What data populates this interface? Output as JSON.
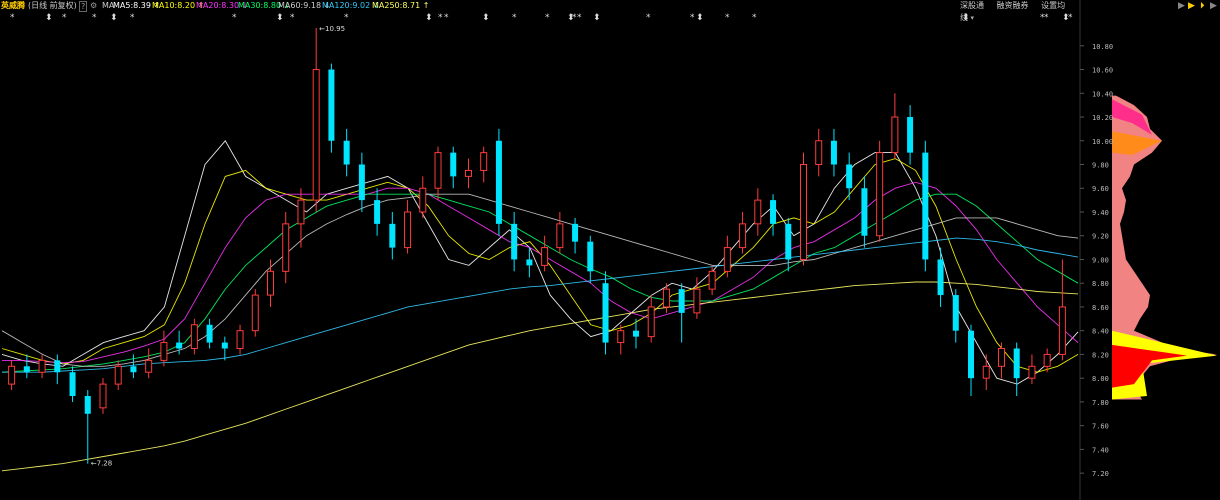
{
  "header": {
    "stock_name": "英威腾",
    "period_label": "(日线 前复权)",
    "help_icon": "?",
    "ma_label": "MA",
    "ma_items": [
      {
        "label": "MA5:8.39",
        "color": "#ffffff",
        "arrow": "↑"
      },
      {
        "label": "MA10:8.20",
        "color": "#ffff00",
        "arrow": "↑"
      },
      {
        "label": "MA20:8.30",
        "color": "#ff33ff",
        "arrow": "↓"
      },
      {
        "label": "MA30:8.80",
        "color": "#00ff66",
        "arrow": "↓"
      },
      {
        "label": "MA60:9.18",
        "color": "#cccccc",
        "arrow": "↓"
      },
      {
        "label": "MA120:9.02",
        "color": "#33ccff",
        "arrow": "↓"
      },
      {
        "label": "MA250:8.71",
        "color": "#ffff66",
        "arrow": "↑"
      }
    ],
    "right_buttons": [
      "深股通",
      "融资融券",
      "设置均线"
    ],
    "right_caret": "▾"
  },
  "chart_data": {
    "type": "candlestick",
    "y_axis": {
      "min": 7.1,
      "max": 10.95,
      "ticks": [
        "10.80",
        "10.60",
        "10.40",
        "10.20",
        "10.00",
        "9.80",
        "9.60",
        "9.40",
        "9.20",
        "9.00",
        "8.80",
        "8.60",
        "8.40",
        "8.20",
        "8.00",
        "7.80",
        "7.60",
        "7.40",
        "7.20"
      ]
    },
    "annotations": [
      {
        "text": "10.95",
        "value": 10.95
      },
      {
        "text": "7.28",
        "value": 7.28
      }
    ],
    "series": [
      {
        "name": "MA5",
        "color": "#ffffff",
        "values": [
          8.2,
          8.15,
          8.12,
          8.1,
          8.2,
          8.3,
          8.35,
          8.4,
          8.6,
          9.2,
          9.8,
          10.0,
          9.7,
          9.6,
          9.5,
          9.4,
          9.55,
          9.6,
          9.65,
          9.7,
          9.6,
          9.3,
          9.0,
          8.95,
          9.1,
          9.25,
          9.1,
          8.7,
          8.5,
          8.35,
          8.4,
          8.55,
          8.7,
          8.8,
          8.75,
          8.9,
          9.1,
          9.3,
          9.45,
          9.2,
          9.3,
          9.6,
          9.8,
          9.9,
          9.9,
          9.6,
          9.2,
          8.6,
          8.3,
          8.0,
          7.95,
          8.05,
          8.2,
          8.39
        ]
      },
      {
        "name": "MA10",
        "color": "#ffff00",
        "values": [
          8.25,
          8.2,
          8.15,
          8.12,
          8.15,
          8.25,
          8.3,
          8.35,
          8.45,
          8.8,
          9.3,
          9.7,
          9.75,
          9.6,
          9.55,
          9.5,
          9.5,
          9.55,
          9.6,
          9.65,
          9.6,
          9.45,
          9.2,
          9.05,
          9.0,
          9.1,
          9.15,
          8.95,
          8.7,
          8.45,
          8.4,
          8.45,
          8.55,
          8.7,
          8.75,
          8.8,
          8.95,
          9.1,
          9.3,
          9.35,
          9.3,
          9.4,
          9.6,
          9.8,
          9.85,
          9.75,
          9.45,
          9.0,
          8.6,
          8.3,
          8.1,
          8.05,
          8.1,
          8.2
        ]
      },
      {
        "name": "MA20",
        "color": "#ff33ff",
        "values": [
          8.15,
          8.15,
          8.14,
          8.13,
          8.14,
          8.18,
          8.22,
          8.27,
          8.33,
          8.5,
          8.8,
          9.1,
          9.35,
          9.5,
          9.55,
          9.55,
          9.55,
          9.55,
          9.55,
          9.6,
          9.6,
          9.55,
          9.45,
          9.35,
          9.25,
          9.15,
          9.1,
          9.0,
          8.9,
          8.8,
          8.65,
          8.55,
          8.5,
          8.55,
          8.6,
          8.65,
          8.75,
          8.85,
          9.0,
          9.1,
          9.15,
          9.25,
          9.35,
          9.5,
          9.6,
          9.65,
          9.6,
          9.45,
          9.25,
          9.0,
          8.8,
          8.6,
          8.45,
          8.3
        ]
      },
      {
        "name": "MA30",
        "color": "#00ff66",
        "values": [
          8.05,
          8.06,
          8.07,
          8.08,
          8.1,
          8.12,
          8.15,
          8.18,
          8.22,
          8.3,
          8.5,
          8.75,
          8.95,
          9.1,
          9.25,
          9.35,
          9.45,
          9.5,
          9.55,
          9.55,
          9.55,
          9.55,
          9.5,
          9.45,
          9.4,
          9.3,
          9.2,
          9.1,
          9.0,
          8.92,
          8.85,
          8.75,
          8.68,
          8.65,
          8.65,
          8.65,
          8.7,
          8.75,
          8.85,
          8.95,
          9.05,
          9.1,
          9.2,
          9.3,
          9.4,
          9.5,
          9.55,
          9.55,
          9.45,
          9.3,
          9.15,
          9.0,
          8.9,
          8.8
        ]
      },
      {
        "name": "MA60",
        "color": "#cccccc",
        "values": [
          8.4,
          8.3,
          8.2,
          8.12,
          8.1,
          8.1,
          8.12,
          8.15,
          8.2,
          8.25,
          8.35,
          8.5,
          8.7,
          8.9,
          9.05,
          9.2,
          9.3,
          9.38,
          9.45,
          9.5,
          9.52,
          9.55,
          9.55,
          9.55,
          9.5,
          9.45,
          9.4,
          9.35,
          9.3,
          9.25,
          9.2,
          9.15,
          9.1,
          9.05,
          9.0,
          8.95,
          8.95,
          8.95,
          8.95,
          8.98,
          9.0,
          9.05,
          9.1,
          9.15,
          9.2,
          9.25,
          9.3,
          9.35,
          9.35,
          9.35,
          9.3,
          9.25,
          9.2,
          9.18
        ]
      },
      {
        "name": "MA120",
        "color": "#33ccff",
        "values": [
          8.05,
          8.05,
          8.05,
          8.06,
          8.07,
          8.08,
          8.1,
          8.12,
          8.13,
          8.14,
          8.15,
          8.17,
          8.2,
          8.25,
          8.3,
          8.35,
          8.4,
          8.45,
          8.5,
          8.55,
          8.6,
          8.63,
          8.66,
          8.69,
          8.72,
          8.75,
          8.77,
          8.78,
          8.8,
          8.82,
          8.84,
          8.86,
          8.88,
          8.9,
          8.92,
          8.94,
          8.96,
          8.98,
          9.0,
          9.02,
          9.04,
          9.06,
          9.08,
          9.1,
          9.12,
          9.14,
          9.16,
          9.18,
          9.17,
          9.15,
          9.12,
          9.08,
          9.05,
          9.02
        ]
      },
      {
        "name": "MA250",
        "color": "#ffff66",
        "values": [
          7.22,
          7.24,
          7.26,
          7.28,
          7.31,
          7.34,
          7.37,
          7.4,
          7.43,
          7.47,
          7.52,
          7.57,
          7.62,
          7.68,
          7.74,
          7.8,
          7.86,
          7.92,
          7.98,
          8.04,
          8.1,
          8.16,
          8.22,
          8.28,
          8.32,
          8.36,
          8.4,
          8.43,
          8.46,
          8.49,
          8.52,
          8.55,
          8.58,
          8.6,
          8.62,
          8.64,
          8.66,
          8.68,
          8.7,
          8.72,
          8.74,
          8.76,
          8.78,
          8.79,
          8.8,
          8.81,
          8.81,
          8.8,
          8.79,
          8.77,
          8.75,
          8.73,
          8.72,
          8.71
        ]
      }
    ],
    "candles": [
      {
        "o": 7.95,
        "c": 8.1,
        "h": 8.15,
        "l": 7.9
      },
      {
        "o": 8.1,
        "c": 8.05,
        "h": 8.2,
        "l": 8.0
      },
      {
        "o": 8.05,
        "c": 8.15,
        "h": 8.2,
        "l": 8.0
      },
      {
        "o": 8.15,
        "c": 8.05,
        "h": 8.2,
        "l": 7.95
      },
      {
        "o": 8.05,
        "c": 7.85,
        "h": 8.1,
        "l": 7.8
      },
      {
        "o": 7.85,
        "c": 7.7,
        "h": 7.9,
        "l": 7.28
      },
      {
        "o": 7.75,
        "c": 7.95,
        "h": 8.0,
        "l": 7.7
      },
      {
        "o": 7.95,
        "c": 8.1,
        "h": 8.15,
        "l": 7.9
      },
      {
        "o": 8.1,
        "c": 8.05,
        "h": 8.2,
        "l": 8.0
      },
      {
        "o": 8.05,
        "c": 8.15,
        "h": 8.25,
        "l": 8.0
      },
      {
        "o": 8.15,
        "c": 8.3,
        "h": 8.4,
        "l": 8.1
      },
      {
        "o": 8.3,
        "c": 8.25,
        "h": 8.4,
        "l": 8.2
      },
      {
        "o": 8.25,
        "c": 8.45,
        "h": 8.5,
        "l": 8.2
      },
      {
        "o": 8.45,
        "c": 8.3,
        "h": 8.5,
        "l": 8.25
      },
      {
        "o": 8.3,
        "c": 8.25,
        "h": 8.35,
        "l": 8.15
      },
      {
        "o": 8.25,
        "c": 8.4,
        "h": 8.45,
        "l": 8.2
      },
      {
        "o": 8.4,
        "c": 8.7,
        "h": 8.75,
        "l": 8.35
      },
      {
        "o": 8.7,
        "c": 8.9,
        "h": 9.0,
        "l": 8.6
      },
      {
        "o": 8.9,
        "c": 9.3,
        "h": 9.4,
        "l": 8.8
      },
      {
        "o": 9.3,
        "c": 9.5,
        "h": 9.6,
        "l": 9.1
      },
      {
        "o": 9.5,
        "c": 10.6,
        "h": 10.95,
        "l": 9.4
      },
      {
        "o": 10.6,
        "c": 10.0,
        "h": 10.65,
        "l": 9.9
      },
      {
        "o": 10.0,
        "c": 9.8,
        "h": 10.1,
        "l": 9.7
      },
      {
        "o": 9.8,
        "c": 9.5,
        "h": 9.9,
        "l": 9.4
      },
      {
        "o": 9.5,
        "c": 9.3,
        "h": 9.6,
        "l": 9.2
      },
      {
        "o": 9.3,
        "c": 9.1,
        "h": 9.4,
        "l": 9.0
      },
      {
        "o": 9.1,
        "c": 9.4,
        "h": 9.5,
        "l": 9.05
      },
      {
        "o": 9.4,
        "c": 9.6,
        "h": 9.7,
        "l": 9.35
      },
      {
        "o": 9.6,
        "c": 9.9,
        "h": 9.95,
        "l": 9.5
      },
      {
        "o": 9.9,
        "c": 9.7,
        "h": 9.95,
        "l": 9.6
      },
      {
        "o": 9.7,
        "c": 9.75,
        "h": 9.85,
        "l": 9.6
      },
      {
        "o": 9.75,
        "c": 9.9,
        "h": 9.95,
        "l": 9.65
      },
      {
        "o": 10.0,
        "c": 9.3,
        "h": 10.1,
        "l": 9.2
      },
      {
        "o": 9.3,
        "c": 9.0,
        "h": 9.4,
        "l": 8.9
      },
      {
        "o": 9.0,
        "c": 8.95,
        "h": 9.1,
        "l": 8.85
      },
      {
        "o": 8.95,
        "c": 9.1,
        "h": 9.2,
        "l": 8.9
      },
      {
        "o": 9.1,
        "c": 9.3,
        "h": 9.4,
        "l": 9.05
      },
      {
        "o": 9.3,
        "c": 9.15,
        "h": 9.35,
        "l": 9.05
      },
      {
        "o": 9.15,
        "c": 8.9,
        "h": 9.2,
        "l": 8.8
      },
      {
        "o": 8.8,
        "c": 8.3,
        "h": 8.9,
        "l": 8.2
      },
      {
        "o": 8.3,
        "c": 8.4,
        "h": 8.45,
        "l": 8.2
      },
      {
        "o": 8.4,
        "c": 8.35,
        "h": 8.5,
        "l": 8.25
      },
      {
        "o": 8.35,
        "c": 8.6,
        "h": 8.7,
        "l": 8.3
      },
      {
        "o": 8.6,
        "c": 8.75,
        "h": 8.8,
        "l": 8.55
      },
      {
        "o": 8.75,
        "c": 8.55,
        "h": 8.8,
        "l": 8.3
      },
      {
        "o": 8.55,
        "c": 8.75,
        "h": 8.85,
        "l": 8.5
      },
      {
        "o": 8.75,
        "c": 8.9,
        "h": 8.95,
        "l": 8.7
      },
      {
        "o": 8.9,
        "c": 9.1,
        "h": 9.2,
        "l": 8.85
      },
      {
        "o": 9.1,
        "c": 9.3,
        "h": 9.4,
        "l": 9.05
      },
      {
        "o": 9.3,
        "c": 9.5,
        "h": 9.6,
        "l": 9.2
      },
      {
        "o": 9.5,
        "c": 9.3,
        "h": 9.55,
        "l": 9.2
      },
      {
        "o": 9.3,
        "c": 9.0,
        "h": 9.35,
        "l": 8.9
      },
      {
        "o": 9.0,
        "c": 9.8,
        "h": 9.9,
        "l": 8.95
      },
      {
        "o": 9.8,
        "c": 10.0,
        "h": 10.1,
        "l": 9.7
      },
      {
        "o": 10.0,
        "c": 9.8,
        "h": 10.1,
        "l": 9.7
      },
      {
        "o": 9.8,
        "c": 9.6,
        "h": 9.9,
        "l": 9.5
      },
      {
        "o": 9.6,
        "c": 9.2,
        "h": 9.7,
        "l": 9.1
      },
      {
        "o": 9.2,
        "c": 9.9,
        "h": 10.0,
        "l": 9.15
      },
      {
        "o": 9.9,
        "c": 10.2,
        "h": 10.4,
        "l": 9.85
      },
      {
        "o": 10.2,
        "c": 9.9,
        "h": 10.3,
        "l": 9.8
      },
      {
        "o": 9.9,
        "c": 9.0,
        "h": 10.0,
        "l": 8.9
      },
      {
        "o": 9.0,
        "c": 8.7,
        "h": 9.1,
        "l": 8.6
      },
      {
        "o": 8.7,
        "c": 8.4,
        "h": 8.75,
        "l": 8.3
      },
      {
        "o": 8.4,
        "c": 8.0,
        "h": 8.45,
        "l": 7.85
      },
      {
        "o": 8.0,
        "c": 8.1,
        "h": 8.2,
        "l": 7.9
      },
      {
        "o": 8.1,
        "c": 8.25,
        "h": 8.3,
        "l": 8.0
      },
      {
        "o": 8.25,
        "c": 8.0,
        "h": 8.3,
        "l": 7.85
      },
      {
        "o": 8.0,
        "c": 8.1,
        "h": 8.2,
        "l": 7.95
      },
      {
        "o": 8.1,
        "c": 8.2,
        "h": 8.25,
        "l": 8.05
      },
      {
        "o": 8.2,
        "c": 8.6,
        "h": 9.0,
        "l": 8.15
      }
    ],
    "volume_profile": {
      "price_range": [
        7.8,
        10.4
      ]
    }
  },
  "star_marks": [
    "*",
    "*",
    "*",
    "*",
    "*",
    "*",
    "*",
    "*",
    "*",
    "*",
    "*",
    "*",
    "*",
    "*",
    "*",
    "*",
    "*",
    "*",
    "*",
    "*",
    "*",
    "*",
    "*",
    "*",
    "*",
    "*"
  ]
}
